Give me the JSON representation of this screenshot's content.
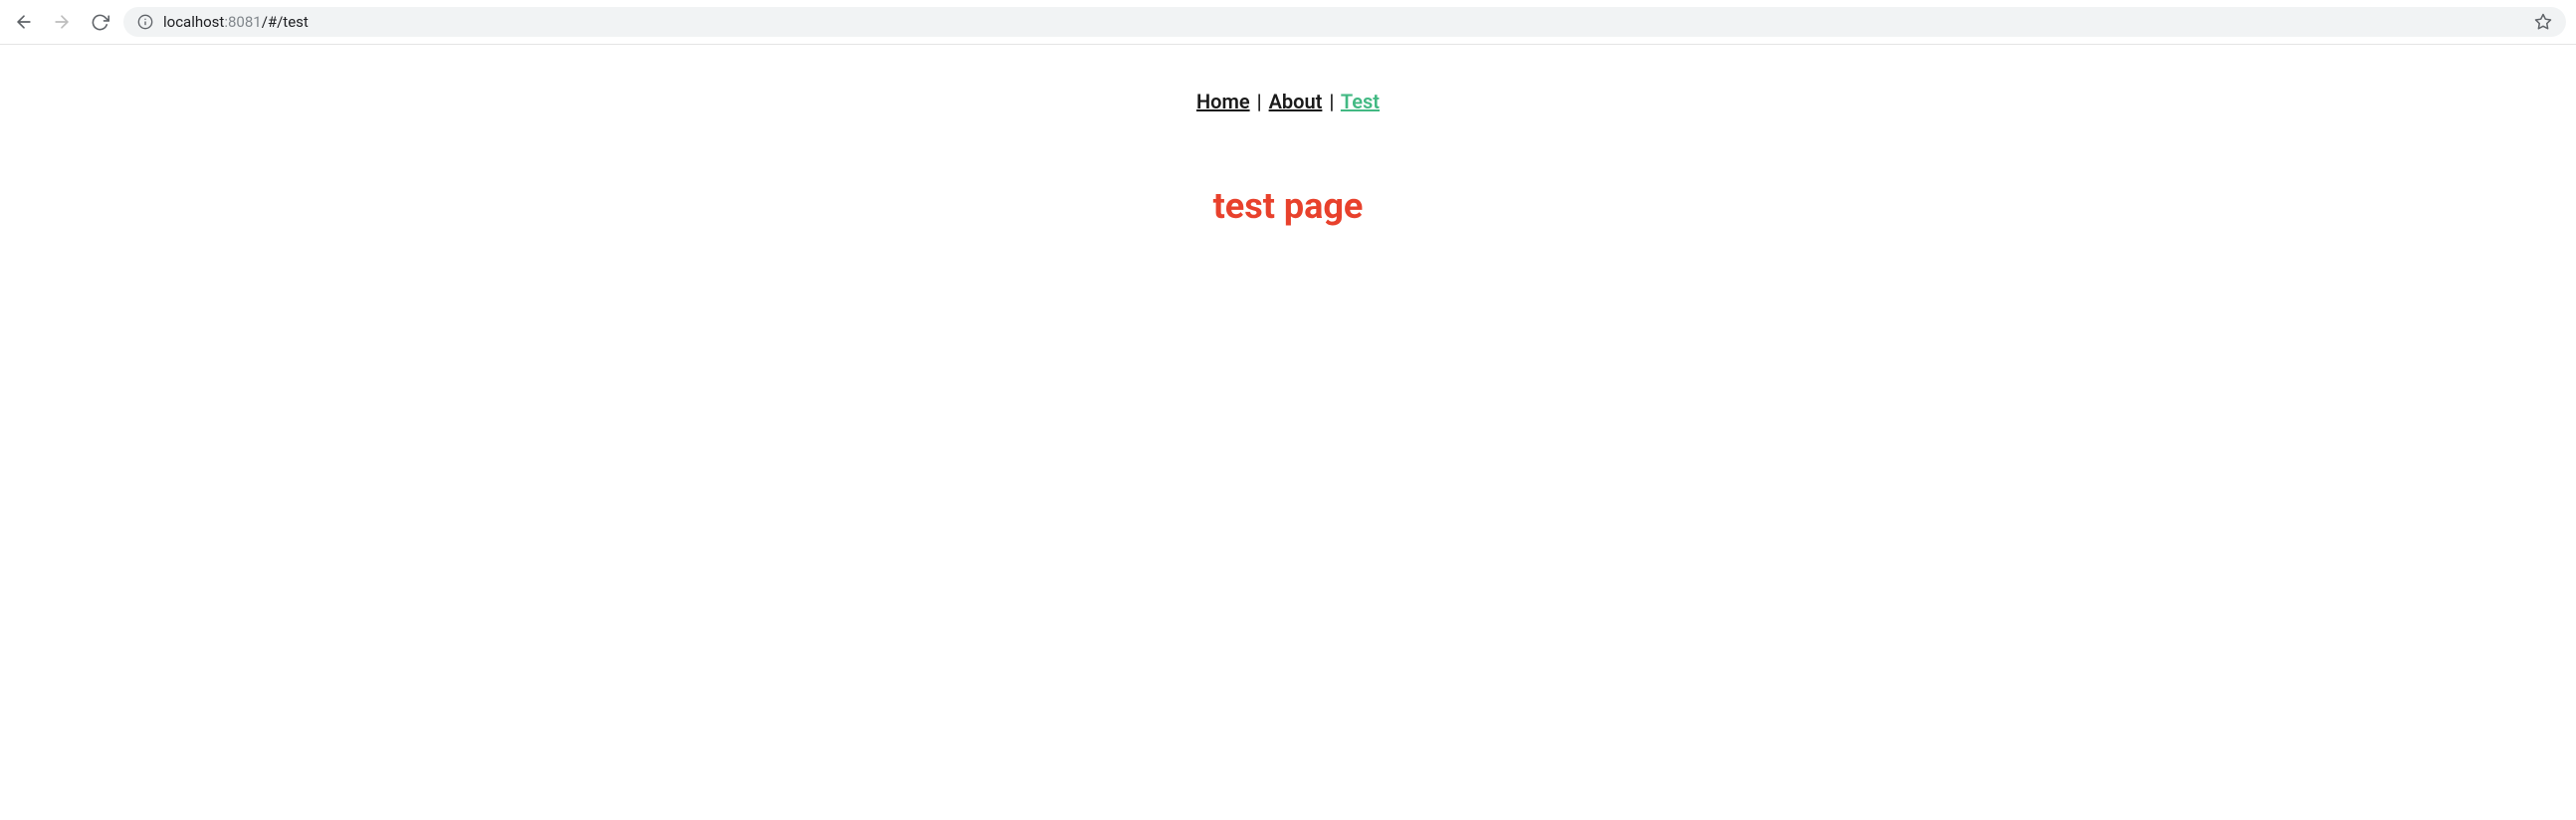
{
  "browser": {
    "url_host": "localhost",
    "url_port": ":8081",
    "url_path": "/#/test"
  },
  "nav": {
    "items": [
      {
        "label": "Home",
        "active": false
      },
      {
        "label": "About",
        "active": false
      },
      {
        "label": "Test",
        "active": true
      }
    ],
    "separator": "|"
  },
  "page": {
    "heading": "test page"
  },
  "colors": {
    "active_link": "#42b983",
    "heading": "#e8412c"
  }
}
